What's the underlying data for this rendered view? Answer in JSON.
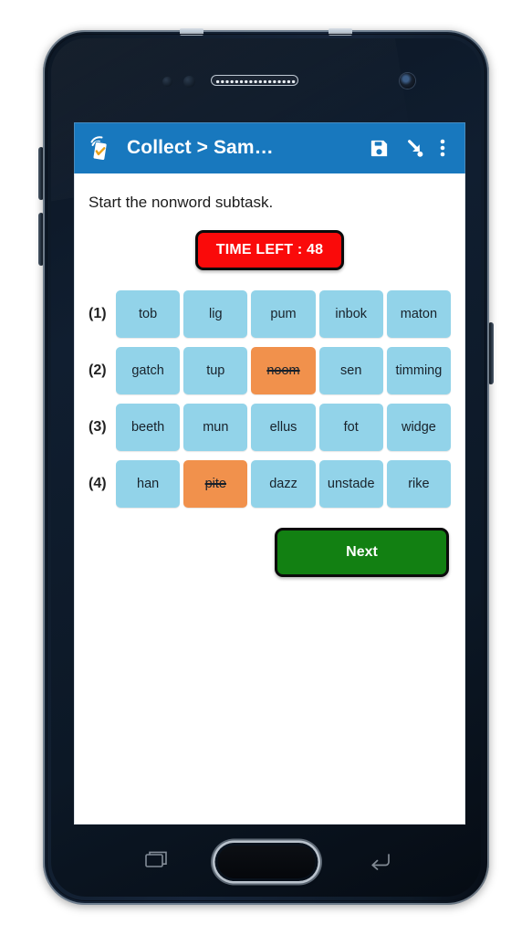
{
  "app": {
    "bar": {
      "logo_icon": "odk-collect-logo-icon",
      "title": "Collect > Sam…",
      "save_icon": "save-floppy-icon",
      "goto_icon": "jump-to-question-arrow-icon",
      "overflow_icon": "overflow-menu-icon"
    },
    "bar_color": "#1878BE"
  },
  "content": {
    "question": "Start the nonword subtask.",
    "timer": {
      "label": "TIME LEFT : 48",
      "bg_color": "#FA0A0A",
      "text_color": "#FFFFFF",
      "border_color": "#0B0B0B"
    },
    "grid": {
      "tile_color": "#92D3E9",
      "selected_color": "#F1914C",
      "rows": [
        {
          "label": "(1)",
          "tiles": [
            {
              "word": "tob",
              "selected": false
            },
            {
              "word": "lig",
              "selected": false
            },
            {
              "word": "pum",
              "selected": false
            },
            {
              "word": "inbok",
              "selected": false
            },
            {
              "word": "maton",
              "selected": false
            }
          ]
        },
        {
          "label": "(2)",
          "tiles": [
            {
              "word": "gatch",
              "selected": false
            },
            {
              "word": "tup",
              "selected": false
            },
            {
              "word": "noom",
              "selected": true
            },
            {
              "word": "sen",
              "selected": false
            },
            {
              "word": "timming",
              "selected": false
            }
          ]
        },
        {
          "label": "(3)",
          "tiles": [
            {
              "word": "beeth",
              "selected": false
            },
            {
              "word": "mun",
              "selected": false
            },
            {
              "word": "ellus",
              "selected": false
            },
            {
              "word": "fot",
              "selected": false
            },
            {
              "word": "widge",
              "selected": false
            }
          ]
        },
        {
          "label": "(4)",
          "tiles": [
            {
              "word": "han",
              "selected": false
            },
            {
              "word": "pite",
              "selected": true
            },
            {
              "word": "dazz",
              "selected": false
            },
            {
              "word": "unstade",
              "selected": false
            },
            {
              "word": "rike",
              "selected": false
            }
          ]
        }
      ]
    },
    "next_button": {
      "label": "Next",
      "bg_color": "#128012",
      "text_color": "#FFFFFF",
      "border_color": "#0B0B0B"
    }
  },
  "device": {
    "nav": {
      "recents_icon": "recents-icon",
      "home_icon": "home-button-icon",
      "back_icon": "back-arrow-icon"
    },
    "hardware": {
      "speaker_icon": "earpiece-speaker-icon",
      "front_camera_icon": "front-camera-icon",
      "proximity_sensor_icon": "proximity-sensor-icon",
      "volume_up_icon": "volume-up-button-icon",
      "volume_down_icon": "volume-down-button-icon",
      "power_icon": "power-button-icon"
    }
  }
}
